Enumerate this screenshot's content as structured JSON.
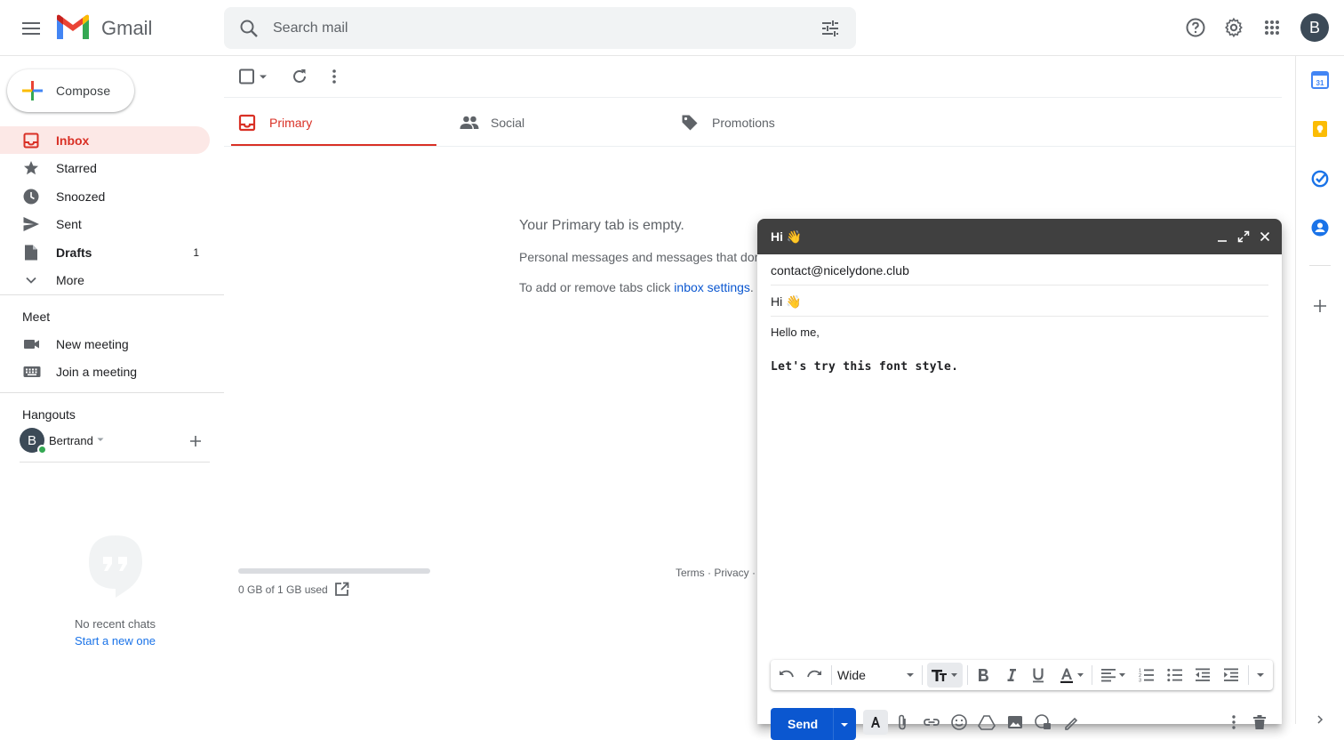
{
  "header": {
    "app_name": "Gmail",
    "search_placeholder": "Search mail",
    "avatar_initial": "B",
    "icons": [
      "menu-icon",
      "gmail-logo",
      "search-icon",
      "tune-icon",
      "help-icon",
      "gear-icon",
      "apps-icon"
    ]
  },
  "sidebar": {
    "compose_label": "Compose",
    "items": [
      {
        "label": "Inbox",
        "icon": "inbox-icon",
        "active": true,
        "count": ""
      },
      {
        "label": "Starred",
        "icon": "star-icon",
        "count": ""
      },
      {
        "label": "Snoozed",
        "icon": "clock-icon",
        "count": ""
      },
      {
        "label": "Sent",
        "icon": "send-icon",
        "count": ""
      },
      {
        "label": "Drafts",
        "icon": "draft-icon",
        "count": "1"
      },
      {
        "label": "More",
        "icon": "chevron-down-icon",
        "count": ""
      }
    ],
    "meet": {
      "title": "Meet",
      "new_meeting": "New meeting",
      "join_meeting": "Join a meeting"
    },
    "hangouts": {
      "title": "Hangouts",
      "user_initial": "B",
      "user_name": "Bertrand",
      "no_chats": "No recent chats",
      "start_new": "Start a new one"
    }
  },
  "main": {
    "tabs": [
      {
        "label": "Primary",
        "active": true
      },
      {
        "label": "Social"
      },
      {
        "label": "Promotions"
      }
    ],
    "empty_title": "Your Primary tab is empty.",
    "empty_line1": "Personal messages and messages that don",
    "empty_line2_prefix": "To add or remove tabs click ",
    "empty_line2_link": "inbox settings",
    "empty_line2_suffix": ".",
    "storage_text": "0 GB of 1 GB used",
    "storage_used_fraction": 0,
    "footer_links": "Terms · Privacy ·"
  },
  "compose_window": {
    "title": "Hi 👋",
    "to": "contact@nicelydone.club",
    "subject": "Hi 👋",
    "body_line1": "Hello me,",
    "body_line2": "Let's try this font style.",
    "font_name": "Wide",
    "send_label": "Send"
  },
  "colors": {
    "accent_red": "#d93025",
    "link_blue": "#0b57d0",
    "compose_header": "#404040",
    "active_bg": "#fce8e6"
  }
}
